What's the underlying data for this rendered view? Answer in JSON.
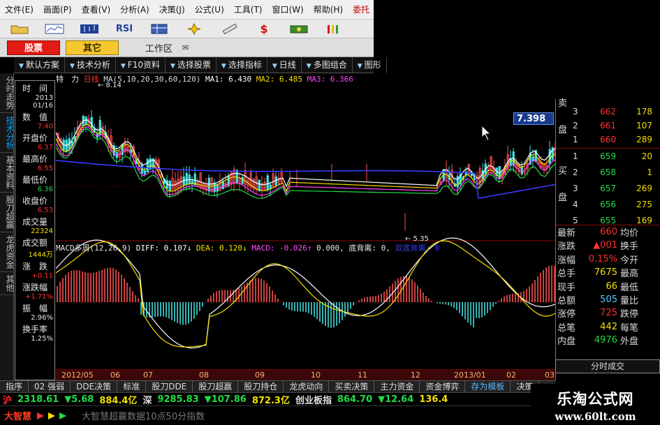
{
  "menu": [
    "文件(E)",
    "画面(P)",
    "查看(V)",
    "分析(A)",
    "决策(J)",
    "公式(U)",
    "工具(T)",
    "窗口(W)",
    "帮助(H)",
    "委托"
  ],
  "toolbar": {
    "rsi_label": "RSI",
    "dollar_label": "$"
  },
  "modes": {
    "stock": "股票",
    "other": "其它",
    "workarea": "工作区",
    "workarea_icon": "✉"
  },
  "funcbar": [
    "默认方案",
    "技术分析",
    "F10资料",
    "选择股票",
    "选择指标",
    "日线",
    "多图组合",
    "图形"
  ],
  "vsidebar": [
    "分时走势",
    "技术分析",
    "基本资料",
    "股刀超赢",
    "龙虎资金",
    "其他"
  ],
  "info": [
    {
      "label": "时　间",
      "values": [
        "2013",
        "01/16"
      ]
    },
    {
      "label": "数　值",
      "values": [
        "7.40"
      ]
    },
    {
      "label": "开盘价",
      "values": [
        "6.37"
      ]
    },
    {
      "label": "最高价",
      "values": [
        "6.55"
      ]
    },
    {
      "label": "最低价",
      "values": [
        "6.36"
      ]
    },
    {
      "label": "收盘价",
      "values": [
        "6.53"
      ]
    },
    {
      "label": "成交量",
      "values": [
        "22324"
      ]
    },
    {
      "label": "成交额",
      "values": [
        "1444万"
      ]
    },
    {
      "label": "涨　跌",
      "values": [
        "+0.11"
      ]
    },
    {
      "label": "涨跌幅",
      "values": [
        "+1.71%"
      ]
    },
    {
      "label": "振　幅",
      "values": [
        "2.96%"
      ]
    },
    {
      "label": "换手率",
      "values": [
        "1.25%"
      ]
    }
  ],
  "chart_header": {
    "tag": "特　力",
    "tag2": "日线",
    "ma": "MA(5,10,20,30,60,120)",
    "ma1": "MA1: 6.430",
    "ma2": "MA2: 6.485",
    "ma3": "MA3: 6.366",
    "high_mark": "8.14",
    "low_mark": "5.35"
  },
  "macd_header": {
    "name": "MACD多周(12,26,9)",
    "diff": "DIFF: 0.107↓",
    "dea": "DEA: 0.120↓",
    "macd": "MACD: -0.026↑",
    "zero": "0.000,",
    "div": "底背离: 0,",
    "extra": "双底背离: 0"
  },
  "price_flag": "7.398",
  "months": [
    "2012/05",
    "06",
    "07",
    "08",
    "09",
    "10",
    "11",
    "12",
    "2013/01",
    "02",
    "03"
  ],
  "orderbook": {
    "sell_label": [
      "卖",
      "盘"
    ],
    "buy_label": [
      "买",
      "盘"
    ],
    "sell": [
      {
        "idx": "3",
        "price": "662",
        "vol": "178"
      },
      {
        "idx": "2",
        "price": "661",
        "vol": "107"
      },
      {
        "idx": "1",
        "price": "660",
        "vol": "289"
      }
    ],
    "buy": [
      {
        "idx": "1",
        "price": "659",
        "vol": "20"
      },
      {
        "idx": "2",
        "price": "658",
        "vol": "1"
      },
      {
        "idx": "3",
        "price": "657",
        "vol": "269"
      },
      {
        "idx": "4",
        "price": "656",
        "vol": "275"
      },
      {
        "idx": "5",
        "price": "655",
        "vol": "169"
      }
    ]
  },
  "stats": [
    {
      "l1": "最新",
      "v1": "660",
      "l2": "均价",
      "c": "#ff3030"
    },
    {
      "l1": "涨跌",
      "v1": "▲001",
      "l2": "换手",
      "c": "#ff3030"
    },
    {
      "l1": "涨幅",
      "v1": "0.15%",
      "l2": "今开",
      "c": "#ff3030"
    },
    {
      "l1": "总手",
      "v1": "7675",
      "l2": "最高",
      "c": "#f5e000"
    },
    {
      "l1": "现手",
      "v1": "66",
      "l2": "最低",
      "c": "#f5e000"
    },
    {
      "l1": "总额",
      "v1": "505",
      "l2": "量比",
      "c": "#4fd0ff"
    },
    {
      "l1": "涨停",
      "v1": "725",
      "l2": "跌停",
      "c": "#ff3030"
    },
    {
      "l1": "总笔",
      "v1": "442",
      "l2": "每笔",
      "c": "#f5e000"
    },
    {
      "l1": "内盘",
      "v1": "4976",
      "l2": "外盘",
      "c": "#22dd44"
    }
  ],
  "tick_button": "分时成交",
  "bottom_tabs": [
    "指序",
    "02 强弱",
    "DDE决策",
    "标准",
    "股刀DDE",
    "股刀超赢",
    "股刀持仓",
    "龙虎动向",
    "买卖决策",
    "主力资金",
    "资金博弈",
    "存为模板",
    "决策"
  ],
  "ticker": {
    "sh_label": "沪",
    "sh_value": "2318.61",
    "sh_change": "▼5.68",
    "sh_amount": "884.4亿",
    "sz_label": "深",
    "sz_value": "9285.83",
    "sz_change": "▼107.86",
    "sz_amount": "872.3亿",
    "cy_label": "创业板指",
    "cy_value": "864.70",
    "cy_change": "▼12.64",
    "cy_amount": "136.4"
  },
  "status": {
    "app": "大智慧",
    "marquee": "大智慧超赢数据10点50分指数"
  },
  "watermark": {
    "title": "乐淘公式网",
    "url": "www.60lt.com"
  },
  "colors": {
    "up": "#ff3030",
    "down": "#22dd44",
    "accent": "#5ab7ff",
    "volume": "#f5e000"
  }
}
